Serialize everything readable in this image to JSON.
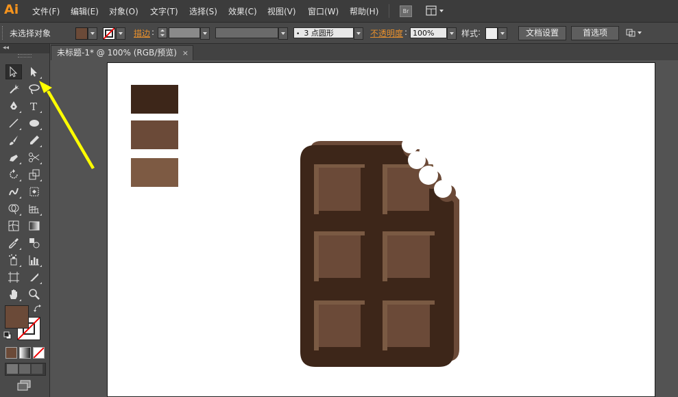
{
  "app": {
    "logo": "Ai"
  },
  "menu": [
    "文件(F)",
    "编辑(E)",
    "对象(O)",
    "文字(T)",
    "选择(S)",
    "效果(C)",
    "视图(V)",
    "窗口(W)",
    "帮助(H)"
  ],
  "bridge_label": "Br",
  "control": {
    "selection_status": "未选择对象",
    "stroke_label": "描边",
    "brush_value": "3 点圆形",
    "opacity_label": "不透明度",
    "opacity_value": "100%",
    "style_label": "样式",
    "doc_setup_button": "文档设置",
    "preferences_button": "首选项"
  },
  "document_tab": {
    "title": "未标题-1* @ 100% (RGB/预览)",
    "close": "×"
  },
  "colors": {
    "swatch1": "#3d2619",
    "swatch2": "#6b4a38",
    "swatch3": "#7d5a43",
    "chocolate_dark": "#3d2619",
    "chocolate_mid": "#6b4a38",
    "chocolate_light": "#7a5a43",
    "fill_color": "#6b4a38",
    "accent": "#f7941d",
    "annotation_arrow": "#ffff00"
  },
  "tools": [
    "selection-tool",
    "direct-selection-tool",
    "magic-wand-tool",
    "lasso-tool",
    "pen-tool",
    "type-tool",
    "line-segment-tool",
    "ellipse-tool",
    "paintbrush-tool",
    "pencil-tool",
    "blob-brush-tool",
    "scissors-tool",
    "rotate-tool",
    "scale-tool",
    "warp-tool",
    "free-transform-tool",
    "shape-builder-tool",
    "perspective-grid-tool",
    "mesh-tool",
    "gradient-tool",
    "eyedropper-tool",
    "blend-tool",
    "symbol-sprayer-tool",
    "column-graph-tool",
    "artboard-tool",
    "slice-tool",
    "hand-tool",
    "zoom-tool"
  ]
}
